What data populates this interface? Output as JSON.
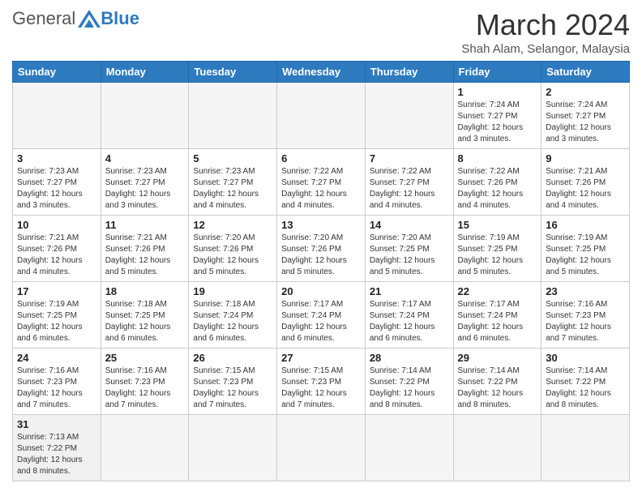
{
  "header": {
    "logo_general": "General",
    "logo_blue": "Blue",
    "month_title": "March 2024",
    "subtitle": "Shah Alam, Selangor, Malaysia"
  },
  "weekdays": [
    "Sunday",
    "Monday",
    "Tuesday",
    "Wednesday",
    "Thursday",
    "Friday",
    "Saturday"
  ],
  "weeks": [
    [
      {
        "day": "",
        "info": ""
      },
      {
        "day": "",
        "info": ""
      },
      {
        "day": "",
        "info": ""
      },
      {
        "day": "",
        "info": ""
      },
      {
        "day": "",
        "info": ""
      },
      {
        "day": "1",
        "info": "Sunrise: 7:24 AM\nSunset: 7:27 PM\nDaylight: 12 hours and 3 minutes."
      },
      {
        "day": "2",
        "info": "Sunrise: 7:24 AM\nSunset: 7:27 PM\nDaylight: 12 hours and 3 minutes."
      }
    ],
    [
      {
        "day": "3",
        "info": "Sunrise: 7:23 AM\nSunset: 7:27 PM\nDaylight: 12 hours and 3 minutes."
      },
      {
        "day": "4",
        "info": "Sunrise: 7:23 AM\nSunset: 7:27 PM\nDaylight: 12 hours and 3 minutes."
      },
      {
        "day": "5",
        "info": "Sunrise: 7:23 AM\nSunset: 7:27 PM\nDaylight: 12 hours and 4 minutes."
      },
      {
        "day": "6",
        "info": "Sunrise: 7:22 AM\nSunset: 7:27 PM\nDaylight: 12 hours and 4 minutes."
      },
      {
        "day": "7",
        "info": "Sunrise: 7:22 AM\nSunset: 7:27 PM\nDaylight: 12 hours and 4 minutes."
      },
      {
        "day": "8",
        "info": "Sunrise: 7:22 AM\nSunset: 7:26 PM\nDaylight: 12 hours and 4 minutes."
      },
      {
        "day": "9",
        "info": "Sunrise: 7:21 AM\nSunset: 7:26 PM\nDaylight: 12 hours and 4 minutes."
      }
    ],
    [
      {
        "day": "10",
        "info": "Sunrise: 7:21 AM\nSunset: 7:26 PM\nDaylight: 12 hours and 4 minutes."
      },
      {
        "day": "11",
        "info": "Sunrise: 7:21 AM\nSunset: 7:26 PM\nDaylight: 12 hours and 5 minutes."
      },
      {
        "day": "12",
        "info": "Sunrise: 7:20 AM\nSunset: 7:26 PM\nDaylight: 12 hours and 5 minutes."
      },
      {
        "day": "13",
        "info": "Sunrise: 7:20 AM\nSunset: 7:26 PM\nDaylight: 12 hours and 5 minutes."
      },
      {
        "day": "14",
        "info": "Sunrise: 7:20 AM\nSunset: 7:25 PM\nDaylight: 12 hours and 5 minutes."
      },
      {
        "day": "15",
        "info": "Sunrise: 7:19 AM\nSunset: 7:25 PM\nDaylight: 12 hours and 5 minutes."
      },
      {
        "day": "16",
        "info": "Sunrise: 7:19 AM\nSunset: 7:25 PM\nDaylight: 12 hours and 5 minutes."
      }
    ],
    [
      {
        "day": "17",
        "info": "Sunrise: 7:19 AM\nSunset: 7:25 PM\nDaylight: 12 hours and 6 minutes."
      },
      {
        "day": "18",
        "info": "Sunrise: 7:18 AM\nSunset: 7:25 PM\nDaylight: 12 hours and 6 minutes."
      },
      {
        "day": "19",
        "info": "Sunrise: 7:18 AM\nSunset: 7:24 PM\nDaylight: 12 hours and 6 minutes."
      },
      {
        "day": "20",
        "info": "Sunrise: 7:17 AM\nSunset: 7:24 PM\nDaylight: 12 hours and 6 minutes."
      },
      {
        "day": "21",
        "info": "Sunrise: 7:17 AM\nSunset: 7:24 PM\nDaylight: 12 hours and 6 minutes."
      },
      {
        "day": "22",
        "info": "Sunrise: 7:17 AM\nSunset: 7:24 PM\nDaylight: 12 hours and 6 minutes."
      },
      {
        "day": "23",
        "info": "Sunrise: 7:16 AM\nSunset: 7:23 PM\nDaylight: 12 hours and 7 minutes."
      }
    ],
    [
      {
        "day": "24",
        "info": "Sunrise: 7:16 AM\nSunset: 7:23 PM\nDaylight: 12 hours and 7 minutes."
      },
      {
        "day": "25",
        "info": "Sunrise: 7:16 AM\nSunset: 7:23 PM\nDaylight: 12 hours and 7 minutes."
      },
      {
        "day": "26",
        "info": "Sunrise: 7:15 AM\nSunset: 7:23 PM\nDaylight: 12 hours and 7 minutes."
      },
      {
        "day": "27",
        "info": "Sunrise: 7:15 AM\nSunset: 7:23 PM\nDaylight: 12 hours and 7 minutes."
      },
      {
        "day": "28",
        "info": "Sunrise: 7:14 AM\nSunset: 7:22 PM\nDaylight: 12 hours and 8 minutes."
      },
      {
        "day": "29",
        "info": "Sunrise: 7:14 AM\nSunset: 7:22 PM\nDaylight: 12 hours and 8 minutes."
      },
      {
        "day": "30",
        "info": "Sunrise: 7:14 AM\nSunset: 7:22 PM\nDaylight: 12 hours and 8 minutes."
      }
    ],
    [
      {
        "day": "31",
        "info": "Sunrise: 7:13 AM\nSunset: 7:22 PM\nDaylight: 12 hours and 8 minutes."
      },
      {
        "day": "",
        "info": ""
      },
      {
        "day": "",
        "info": ""
      },
      {
        "day": "",
        "info": ""
      },
      {
        "day": "",
        "info": ""
      },
      {
        "day": "",
        "info": ""
      },
      {
        "day": "",
        "info": ""
      }
    ]
  ]
}
